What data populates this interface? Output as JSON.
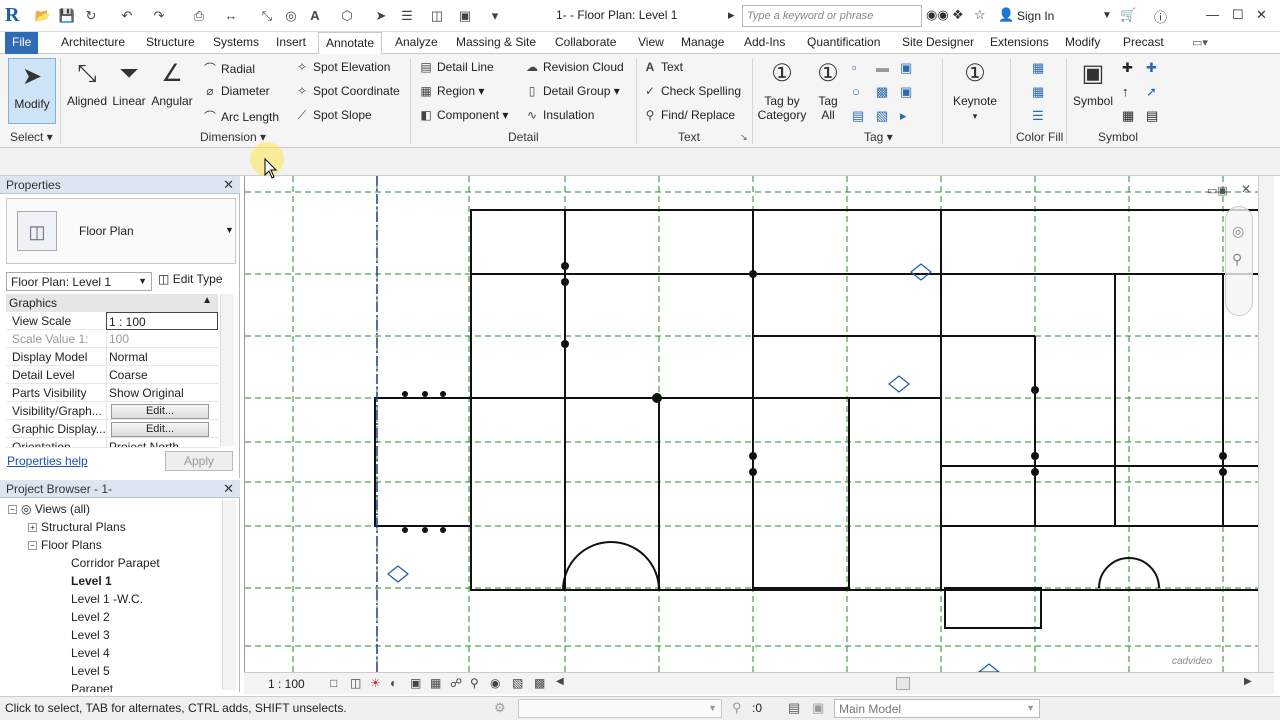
{
  "titlebar": {
    "doc_title": "1- - Floor Plan: Level 1",
    "search_placeholder": "Type a keyword or phrase",
    "signin": "Sign In"
  },
  "ribbon_tabs": [
    "File",
    "Architecture",
    "Structure",
    "Systems",
    "Insert",
    "Annotate",
    "Analyze",
    "Massing & Site",
    "Collaborate",
    "View",
    "Manage",
    "Add-Ins",
    "Quantification",
    "Site Designer",
    "Extensions",
    "Modify",
    "Precast"
  ],
  "active_tab": "Annotate",
  "ribbon": {
    "modify": "Modify",
    "select_label": "Select",
    "dim_big": [
      "Aligned",
      "Linear",
      "Angular"
    ],
    "dim_small": [
      "Radial",
      "Diameter",
      "Arc Length",
      "Spot Elevation",
      "Spot Coordinate",
      "Spot Slope"
    ],
    "dimension_label": "Dimension",
    "detail": [
      "Detail Line",
      "Region",
      "Component",
      "Revision Cloud",
      "Detail Group",
      "Insulation"
    ],
    "detail_label": "Detail",
    "text": [
      "Text",
      "Check Spelling",
      "Find/ Replace"
    ],
    "text_label": "Text",
    "tag_by_category": "Tag by Category",
    "tag_all": "Tag All",
    "tag_label": "Tag",
    "keynote": "Keynote",
    "color_fill_label": "Color Fill",
    "symbol": "Symbol",
    "symbol_label": "Symbol"
  },
  "properties": {
    "title": "Properties",
    "type_name": "Floor Plan",
    "instance": "Floor Plan: Level 1",
    "edit_type": "Edit Type",
    "group": "Graphics",
    "rows": [
      {
        "k": "View Scale",
        "v": "1 : 100"
      },
      {
        "k": "Scale Value    1:",
        "v": "100"
      },
      {
        "k": "Display Model",
        "v": "Normal"
      },
      {
        "k": "Detail Level",
        "v": "Coarse"
      },
      {
        "k": "Parts Visibility",
        "v": "Show Original"
      },
      {
        "k": "Visibility/Graph...",
        "v": "Edit..."
      },
      {
        "k": "Graphic Display...",
        "v": "Edit..."
      },
      {
        "k": "Orientation",
        "v": "Project North"
      }
    ],
    "help": "Properties help",
    "apply": "Apply"
  },
  "browser": {
    "title": "Project Browser - 1-",
    "items": [
      "Views (all)",
      "Structural Plans",
      "Floor Plans",
      "Corridor Parapet",
      "Level 1",
      "Level 1 -W.C.",
      "Level 2",
      "Level 3",
      "Level 4",
      "Level 5",
      "Parapet"
    ]
  },
  "view_control": {
    "scale": "1 : 100"
  },
  "status": {
    "text": "Click to select, TAB for alternates, CTRL adds, SHIFT unselects.",
    "zero": ":0",
    "model": "Main Model"
  },
  "watermark": "cadvideo"
}
